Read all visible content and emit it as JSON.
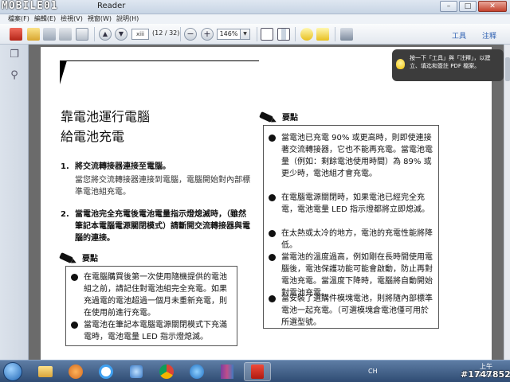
{
  "window": {
    "title": "Reader",
    "watermark_logo": "MOBILE01",
    "minimize": "–",
    "maximize": "□",
    "close": "✕"
  },
  "menu": [
    "檔案(F)",
    "編輯(E)",
    "檢視(V)",
    "視窗(W)",
    "說明(H)"
  ],
  "toolbar": {
    "page_input": "xiii",
    "page_count": "(12 / 32)",
    "zoom": "146%",
    "tools_label": "工具",
    "comment_label": "注释",
    "icons": [
      "create-pdf-icon",
      "open-icon",
      "save-icon",
      "print-icon",
      "email-icon",
      "prev-page-icon",
      "next-page-icon",
      "zoom-out-icon",
      "zoom-in-icon",
      "fit-page-icon",
      "fit-width-icon",
      "comment-icon",
      "highlight-icon",
      "fullscreen-icon"
    ]
  },
  "tooltip": {
    "text": "按一下「工具」與「注釋」，以建立、填迄和簽註 PDF 檔案。"
  },
  "document": {
    "heading1": "靠電池運行電腦",
    "heading2": "給電池充電",
    "steps": [
      {
        "num": "1.",
        "title": "將交流轉接器連接至電腦。",
        "desc": "當您將交流轉接器連接到電腦，電腦開始對內部標準電池組充電。"
      },
      {
        "num": "2.",
        "title": "當電池完全充電後電池電量指示燈熄滅時，（雖然筆記本電腦電源關閉模式）請斷開交流轉接器與電腦的連接。",
        "desc": ""
      }
    ],
    "left_note": {
      "title": "要點",
      "bullets": [
        "在電腦購買後第一次使用隨機提供的電池組之前，請記住對電池組完全充電。如果充過電的電池超過一個月未重新充電，則在使用前進行充電。",
        "當電池在筆記本電腦電源關閉模式下充滿電時，電池電量 LED 指示燈熄滅。"
      ]
    },
    "right_note": {
      "title": "要點",
      "bullets": [
        "當電池已充電 90% 或更高時，則即使連接著交流轉接器，它也不能再充電。當電池電量（例如：剩餘電池使用時間）為 89% 或更少時，電池組才會充電。",
        "在電腦電源關閉時，如果電池已經完全充電，電池電量 LED 指示燈都將立即熄滅。",
        "在太熱或太冷的地方，電池的充電性能將降低。",
        "當電池的溫度過高，例如剛在長時間使用電腦後，電池保護功能可能會啟動，防止再對電池充電。當溫度下降時，電腦將自動開始對電池充電。",
        "當安裝了選購件模塊電池，則將隨內部標準電池一起充電。（可選模塊倉電池僅可用於所選型號。"
      ]
    }
  },
  "taskbar": {
    "ime": "CH",
    "time": "上午 12:21",
    "watermark_id": "#1747852",
    "apps": [
      "start-orb",
      "explorer-icon",
      "media-player-icon",
      "ie-icon",
      "utility-icon",
      "chrome-icon",
      "download-icon",
      "archive-icon",
      "acrobat-icon"
    ]
  }
}
